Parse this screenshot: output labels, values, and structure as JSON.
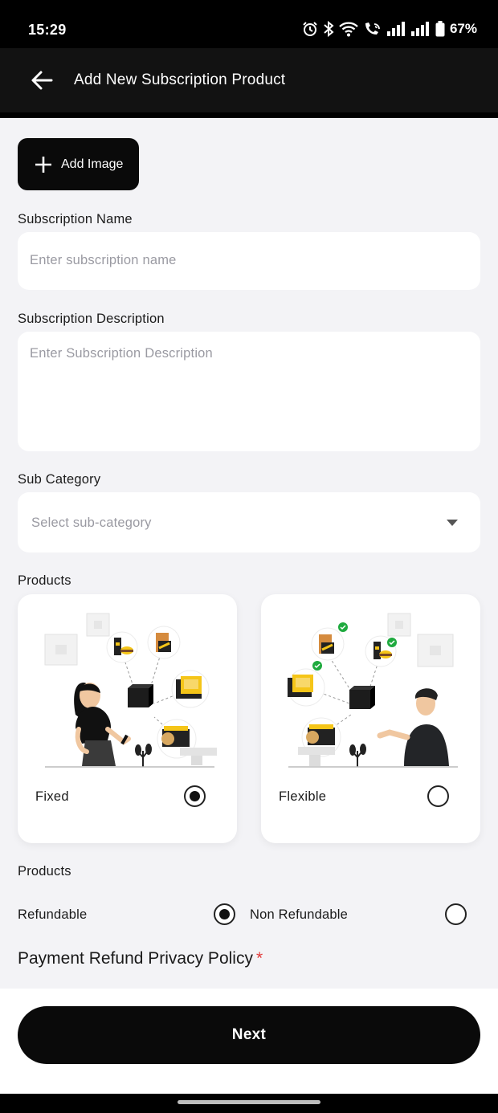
{
  "status_bar": {
    "time": "15:29",
    "battery": "67%"
  },
  "app_bar": {
    "title": "Add New Subscription Product",
    "back_icon": "arrow-left-icon"
  },
  "add_image": {
    "label": "Add Image"
  },
  "subscription_name": {
    "label": "Subscription Name",
    "placeholder": "Enter subscription name"
  },
  "subscription_description": {
    "label": "Subscription Description",
    "placeholder": "Enter Subscription Description"
  },
  "sub_category": {
    "label": "Sub Category",
    "placeholder": "Select sub-category"
  },
  "products_type": {
    "label": "Products",
    "options": [
      {
        "label": "Fixed",
        "selected": true
      },
      {
        "label": "Flexible",
        "selected": false
      }
    ]
  },
  "refund": {
    "label": "Products",
    "options": [
      {
        "label": "Refundable",
        "selected": true
      },
      {
        "label": "Non Refundable",
        "selected": false
      }
    ]
  },
  "policy": {
    "label": "Payment Refund Privacy Policy",
    "required_mark": "*"
  },
  "next_button": {
    "label": "Next"
  },
  "colors": {
    "primary": "#0a0a0a",
    "background": "#f3f3f6",
    "accent_yellow": "#f5c518",
    "required_red": "#e23b3b",
    "check_green": "#1faa3f"
  }
}
